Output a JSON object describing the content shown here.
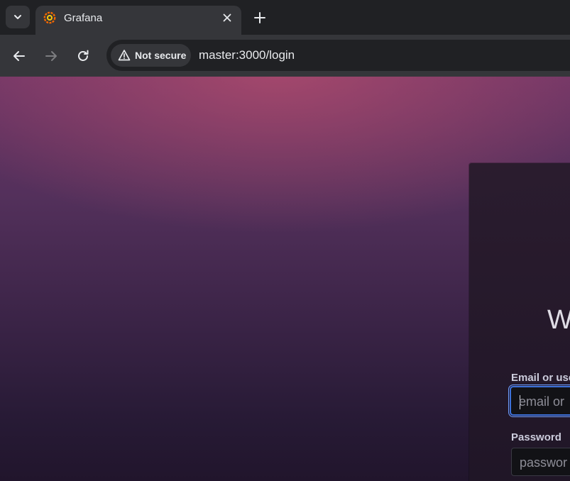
{
  "browser": {
    "tab": {
      "title": "Grafana",
      "favicon": "grafana-logo-icon"
    },
    "tab_search_icon": "chevron-down-icon",
    "new_tab_icon": "plus-icon",
    "close_icon": "close-icon",
    "nav": {
      "back_icon": "arrow-left-icon",
      "forward_icon": "arrow-right-icon",
      "reload_icon": "reload-icon"
    },
    "security": {
      "icon": "warning-icon",
      "label": "Not secure"
    },
    "url": "master:3000/login"
  },
  "login": {
    "welcome_text": "W",
    "email": {
      "label": "Email or use",
      "placeholder": "email or",
      "value": ""
    },
    "password": {
      "label": "Password",
      "placeholder": "passwor",
      "value": ""
    }
  },
  "colors": {
    "focus_border": "#3d71d9",
    "page_top": "#6c3566",
    "page_bottom": "#21152c",
    "favicon": "#f46800"
  }
}
